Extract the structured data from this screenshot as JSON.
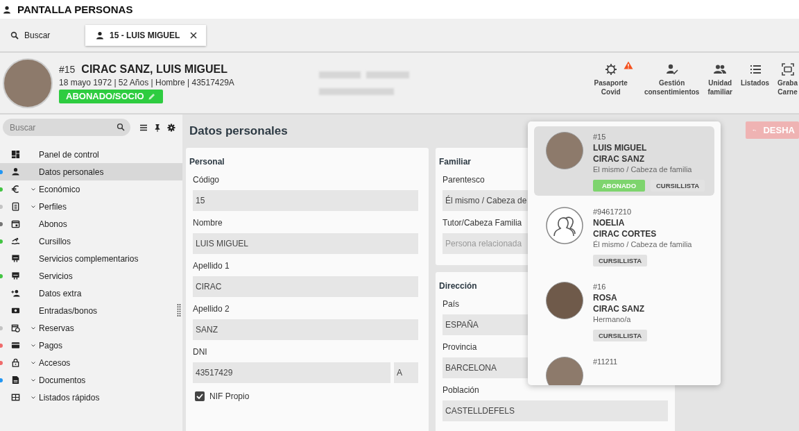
{
  "app_title": "PANTALLA PERSONAS",
  "tabs": [
    {
      "kind": "search",
      "label": "Buscar",
      "selected": false
    },
    {
      "kind": "record",
      "label": "15 - LUIS MIGUEL",
      "selected": true
    }
  ],
  "person": {
    "number": "#15",
    "name": "CIRAC SANZ, LUIS MIGUEL",
    "details": "18 mayo 1972 | 52 Años | Hombre | 43517429A",
    "status": "ABONADO/SOCIO"
  },
  "toolbar": [
    {
      "lines": [
        "Pasaporte",
        "Covid"
      ],
      "warning": true
    },
    {
      "lines": [
        "Gestión",
        "consentimientos"
      ],
      "warning": false
    },
    {
      "lines": [
        "Unidad",
        "familiar"
      ],
      "warning": false
    },
    {
      "lines": [
        "Listados"
      ],
      "warning": false
    },
    {
      "lines": [
        "Graba",
        "Carne"
      ],
      "warning": false
    }
  ],
  "sidebar": {
    "search_placeholder": "Buscar",
    "items": [
      {
        "label": "Panel de control",
        "expandable": false,
        "selected": false
      },
      {
        "label": "Datos personales",
        "color": "#2196f3",
        "expandable": false,
        "selected": true
      },
      {
        "label": "Económico",
        "color": "#43c443",
        "expandable": true,
        "selected": false
      },
      {
        "label": "Perfiles",
        "color": "#c4c4c4",
        "expandable": true,
        "selected": false
      },
      {
        "label": "Abonos",
        "color": "#757575",
        "expandable": false,
        "selected": false
      },
      {
        "label": "Cursillos",
        "color": "#43c443",
        "expandable": false,
        "selected": false
      },
      {
        "label": "Servicios complementarios",
        "expandable": false,
        "selected": false
      },
      {
        "label": "Servicios",
        "color": "#43c443",
        "expandable": false,
        "selected": false
      },
      {
        "label": "Datos extra",
        "expandable": false,
        "selected": false
      },
      {
        "label": "Entradas/bonos",
        "expandable": false,
        "selected": false
      },
      {
        "label": "Reservas",
        "color": "#c4c4c4",
        "expandable": true,
        "selected": false
      },
      {
        "label": "Pagos",
        "color": "#ef6b6b",
        "expandable": true,
        "selected": false
      },
      {
        "label": "Accesos",
        "color": "#ef6b6b",
        "expandable": true,
        "selected": false
      },
      {
        "label": "Documentos",
        "color": "#2196f3",
        "expandable": true,
        "selected": false
      },
      {
        "label": "Listados rápidos",
        "expandable": true,
        "selected": false
      }
    ]
  },
  "content": {
    "title": "Datos personales",
    "personal": {
      "title": "Personal",
      "fields": [
        {
          "label": "Código",
          "value": "15"
        },
        {
          "label": "Nombre",
          "value": "LUIS MIGUEL"
        },
        {
          "label": "Apellido 1",
          "value": "CIRAC"
        },
        {
          "label": "Apellido 2",
          "value": "SANZ"
        },
        {
          "label": "DNI",
          "value": "43517429",
          "suffix": "A"
        }
      ],
      "nif": {
        "label": "NIF Propio",
        "checked": true
      }
    },
    "familiar": {
      "title": "Familiar",
      "fields": [
        {
          "label": "Parentesco",
          "value": "Él mismo / Cabeza de"
        },
        {
          "label": "Tutor/Cabeza Familia",
          "placeholder": "Persona relacionada"
        }
      ]
    },
    "direccion": {
      "title": "Dirección",
      "fields": [
        {
          "label": "País",
          "value": "ESPAÑA"
        },
        {
          "label": "Provincia",
          "value": "BARCELONA"
        },
        {
          "label": "Población",
          "value": "CASTELLDEFELS"
        }
      ]
    }
  },
  "undo_button": {
    "label": "DESHA",
    "disabled": true
  },
  "family_popup": {
    "members": [
      {
        "number": "#15",
        "first_name": "LUIS MIGUEL",
        "last_name": "CIRAC SANZ",
        "relation": "El mismo / Cabeza de familia",
        "has_photo": true,
        "selected": true,
        "tags": [
          {
            "label": "ABONADO",
            "kind": "member"
          },
          {
            "label": "CURSILLISTA",
            "kind": "course"
          }
        ]
      },
      {
        "number": "#94617210",
        "first_name": "NOELIA",
        "last_name": "CIRAC CORTES",
        "relation": "Él mismo / Cabeza de familia",
        "has_photo": false,
        "selected": false,
        "tags": [
          {
            "label": "CURSILLISTA",
            "kind": "course"
          }
        ]
      },
      {
        "number": "#16",
        "first_name": "ROSA",
        "last_name": "CIRAC SANZ",
        "relation": "Hermano/a",
        "has_photo": true,
        "selected": false,
        "tags": [
          {
            "label": "CURSILLISTA",
            "kind": "course"
          }
        ]
      },
      {
        "number": "#11211",
        "has_photo": true,
        "selected": false
      }
    ]
  }
}
